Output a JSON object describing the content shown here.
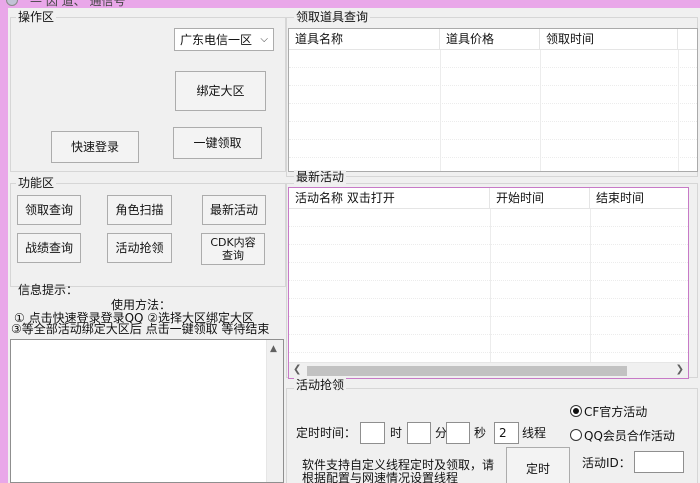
{
  "window": {
    "title": "— 因 道、 通信号"
  },
  "operation": {
    "title": "操作区",
    "region_select": "广东电信一区",
    "bind_button": "绑定大区",
    "quick_login_button": "快速登录",
    "one_click_button": "一键领取"
  },
  "items": {
    "title": "领取道具查询",
    "columns": [
      "道具名称",
      "道具价格",
      "领取时间"
    ]
  },
  "functions": {
    "title": "功能区",
    "buttons": [
      "领取查询",
      "角色扫描",
      "最新活动",
      "战绩查询",
      "活动抢领",
      "CDK内容查询"
    ]
  },
  "latest": {
    "title": "最新活动",
    "columns": [
      "活动名称 双击打开",
      "开始时间",
      "结束时间"
    ]
  },
  "info": {
    "title": "信息提示：",
    "usage_title": "使用方法：",
    "line1": "① 点击快速登录登录QQ  ②选择大区绑定大区",
    "line2": "③等全部活动绑定大区后 点击一键领取 等待结束"
  },
  "grab": {
    "title": "活动抢领",
    "timer_label": "定时时间：",
    "hour_label": "时",
    "minute_label": "分",
    "second_label": "秒",
    "threads_value": "2",
    "threads_label": "线程",
    "radio_cf": "CF官方活动",
    "radio_qq": "QQ会员合作活动",
    "note_line1": "软件支持自定义线程定时及领取，请",
    "note_line2": "根据配置与网速情况设置线程",
    "timer_button": "定时",
    "activity_id_label": "活动ID："
  }
}
